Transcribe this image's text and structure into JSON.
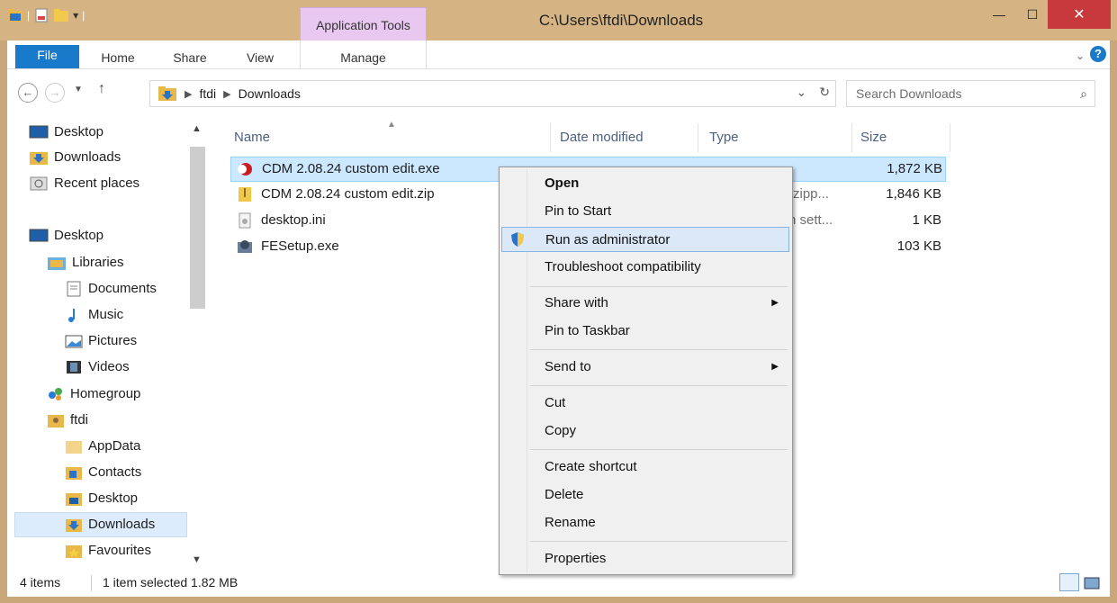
{
  "window": {
    "title": "C:\\Users\\ftdi\\Downloads",
    "context_tab": "Application Tools",
    "minimize": "—",
    "maximize": "☐",
    "close": "✕"
  },
  "ribbon": {
    "tabs": [
      "File",
      "Home",
      "Share",
      "View",
      "Manage"
    ],
    "help": "?"
  },
  "address": {
    "crumbs": [
      "ftdi",
      "Downloads"
    ],
    "search_placeholder": "Search Downloads"
  },
  "nav": [
    {
      "label": "Desktop",
      "icon": "desktop-icon"
    },
    {
      "label": "Downloads",
      "icon": "downloads-folder-icon"
    },
    {
      "label": "Recent places",
      "icon": "recent-places-icon"
    },
    {
      "label": "Desktop",
      "icon": "desktop-icon"
    },
    {
      "label": "Libraries",
      "icon": "libraries-icon"
    },
    {
      "label": "Documents",
      "icon": "documents-icon"
    },
    {
      "label": "Music",
      "icon": "music-icon"
    },
    {
      "label": "Pictures",
      "icon": "pictures-icon"
    },
    {
      "label": "Videos",
      "icon": "videos-icon"
    },
    {
      "label": "Homegroup",
      "icon": "homegroup-icon"
    },
    {
      "label": "ftdi",
      "icon": "user-folder-icon"
    },
    {
      "label": "AppData",
      "icon": "folder-icon"
    },
    {
      "label": "Contacts",
      "icon": "contacts-icon"
    },
    {
      "label": "Desktop",
      "icon": "desktop-folder-icon"
    },
    {
      "label": "Downloads",
      "icon": "downloads-folder-icon"
    },
    {
      "label": "Favourites",
      "icon": "favourites-icon"
    }
  ],
  "columns": [
    "Name",
    "Date modified",
    "Type",
    "Size"
  ],
  "files": [
    {
      "name": "CDM 2.08.24 custom edit.exe",
      "type": "",
      "size": "1,872 KB",
      "icon": "exe-red-icon"
    },
    {
      "name": "CDM 2.08.24 custom edit.zip",
      "type": "(zipp...",
      "size": "1,846 KB",
      "icon": "zip-icon"
    },
    {
      "name": "desktop.ini",
      "type": "n sett...",
      "size": "1 KB",
      "icon": "ini-icon"
    },
    {
      "name": "FESetup.exe",
      "type": "",
      "size": "103 KB",
      "icon": "setup-icon"
    }
  ],
  "context_menu": {
    "items": [
      "Open",
      "Pin to Start",
      "Run as administrator",
      "Troubleshoot compatibility",
      "Share with",
      "Pin to Taskbar",
      "Send to",
      "Cut",
      "Copy",
      "Create shortcut",
      "Delete",
      "Rename",
      "Properties"
    ],
    "submenu_arrow": "▶"
  },
  "status": {
    "count": "4 items",
    "selection": "1 item selected  1.82 MB"
  }
}
